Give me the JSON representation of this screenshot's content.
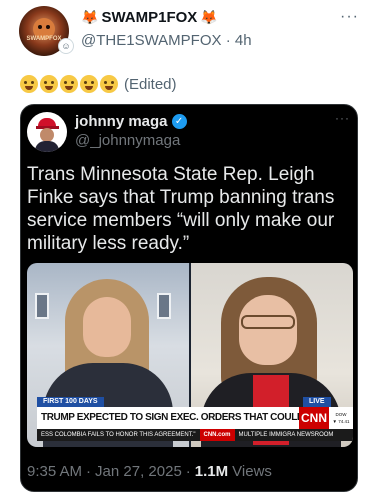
{
  "author": {
    "display_name": "SWAMP1FOX",
    "handle": "@THE1SWAMPFOX",
    "time_ago": "4h",
    "avatar_text": "SWAMPFOX"
  },
  "post": {
    "edited_label": "(Edited)"
  },
  "quoted_post": {
    "display_name": "johnny maga",
    "handle": "@_johnnymaga",
    "text": "Trans Minnesota State Rep. Leigh Finke says that Trump banning trans service members “will only make our military less ready.”",
    "video": {
      "chyron_tag": "FIRST 100 DAYS",
      "live_label": "LIVE",
      "headline": "TRUMP EXPECTED TO SIGN EXEC. ORDERS THAT COULD RESHAPE MILITARY",
      "network": "CNN",
      "dow_label": "DOW",
      "dow_value": "▼ 74.41",
      "ticker_left": "ESS COLOMBIA FAILS TO HONOR THIS AGREEMENT.\"",
      "ticker_brand": "CNN.com",
      "ticker_right": "MULTIPLE IMMIGRA NEWSROOM"
    },
    "time": "9:35 AM",
    "date": "Jan 27, 2025",
    "views_count": "1.1M",
    "views_label": "Views"
  },
  "colors": {
    "verified": "#1d9bf0",
    "cnn_red": "#cc0000",
    "chyron_blue": "#1f4fa3"
  },
  "icons": [
    "fox-icon",
    "verified-icon",
    "more-icon",
    "emoji-icon"
  ]
}
